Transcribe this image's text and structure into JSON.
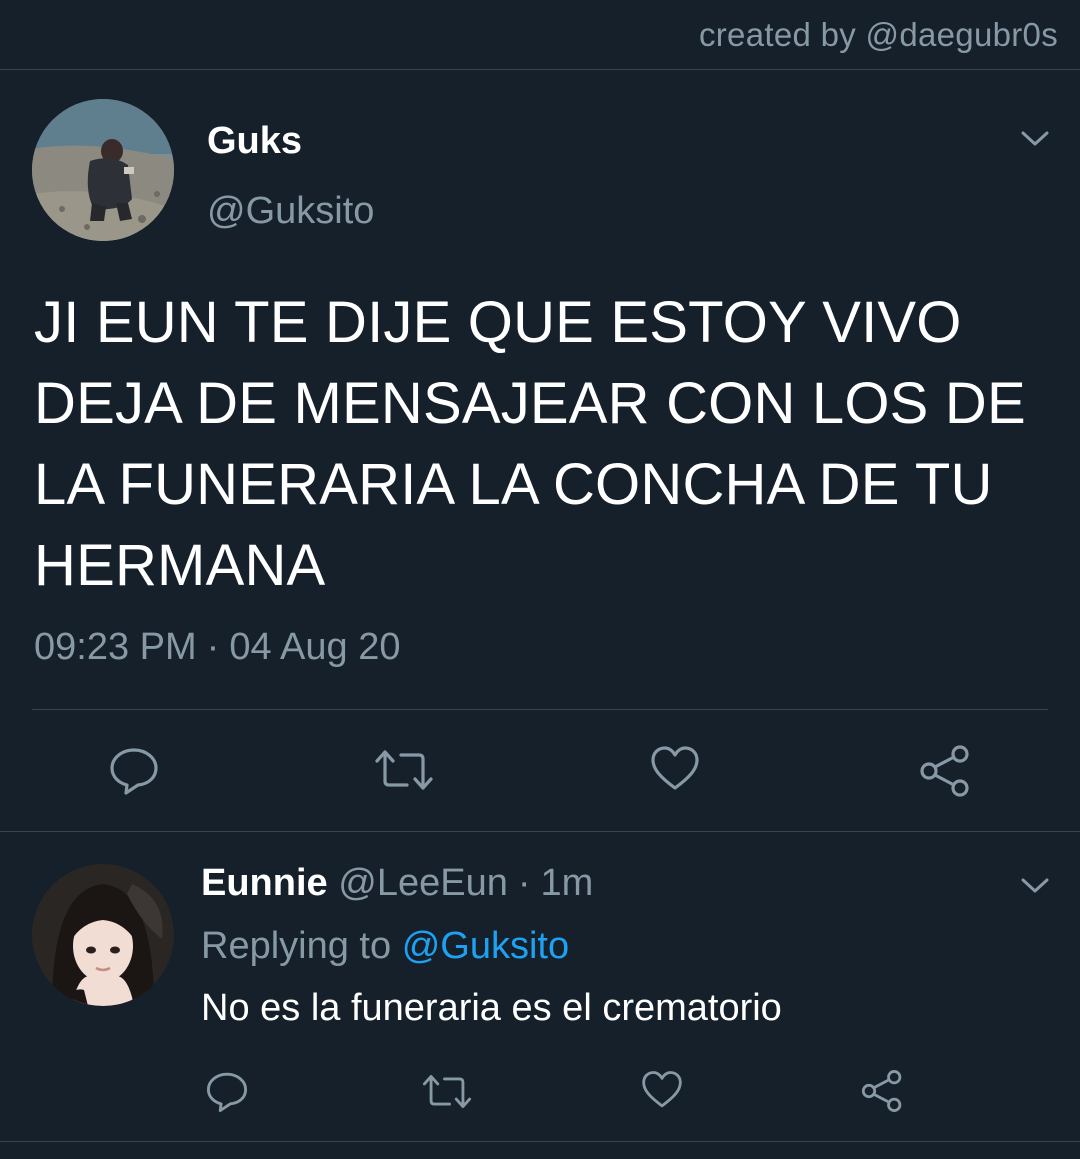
{
  "header": {
    "credit": "created by @daegubr0s"
  },
  "tweet": {
    "author_name": "Guks",
    "author_handle": "@Guksito",
    "text": "JI EUN TE DIJE QUE ESTOY VIVO DEJA DE MENSAJEAR CON LOS DE LA FUNERARIA LA CONCHA DE TU HERMANA",
    "time": "09:23 PM",
    "separator": "·",
    "date": "04 Aug 20",
    "actions": [
      "reply-icon",
      "retweet-icon",
      "like-icon",
      "share-icon"
    ]
  },
  "reply": {
    "author_name": "Eunnie",
    "author_handle": "@LeeEun",
    "separator": "·",
    "age": "1m",
    "replying_label": "Replying to",
    "replying_to": "@Guksito",
    "text": "No es la funeraria es el crematorio",
    "actions": [
      "reply-icon",
      "retweet-icon",
      "like-icon",
      "share-icon"
    ]
  },
  "colors": {
    "background": "#15202b",
    "divider": "#38444d",
    "secondary_text": "#8899a6",
    "mention": "#1da1f2",
    "primary_text": "#ffffff"
  }
}
